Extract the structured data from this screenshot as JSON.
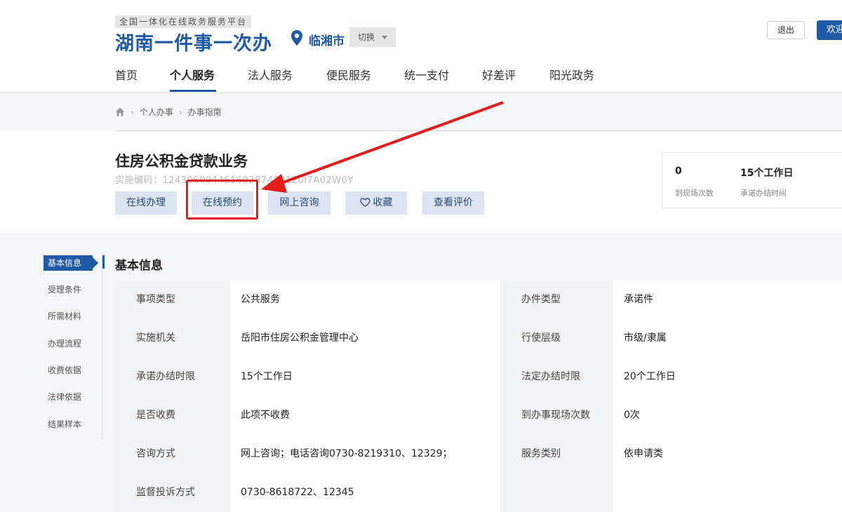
{
  "header": {
    "platform_tag": "全国一体化在线政务服务平台",
    "brand": "湖南一件事一次办",
    "city": "临湘市",
    "switch_label": "切换",
    "logout_label": "退出",
    "welcome_label": "欢迎"
  },
  "nav": {
    "items": [
      "首页",
      "个人服务",
      "法人服务",
      "便民服务",
      "统一支付",
      "好差评",
      "阳光政务"
    ],
    "active_index": 1
  },
  "breadcrumb": {
    "items": [
      "个人办事",
      "办事指南"
    ]
  },
  "service": {
    "title": "住房公积金贷款业务",
    "code": "实施编码：12430600446169287434120I7A02W0Y",
    "buttons": [
      "在线办理",
      "在线预约",
      "网上咨询",
      "收藏",
      "查看评价"
    ]
  },
  "stats": {
    "visits_value": "0",
    "visits_label": "到现场次数",
    "time_value": "15个工作日",
    "time_label": "承诺办结时间"
  },
  "sidebar": {
    "items": [
      "基本信息",
      "受理条件",
      "所需材料",
      "办理流程",
      "收费依据",
      "法律依据",
      "结果样本"
    ]
  },
  "section": {
    "title": "基本信息"
  },
  "table": {
    "rows": [
      [
        "事项类型",
        "公共服务",
        "办件类型",
        "承诺件"
      ],
      [
        "实施机关",
        "岳阳市住房公积金管理中心",
        "行使层级",
        "市级/隶属"
      ],
      [
        "承诺办结时限",
        "15个工作日",
        "法定办结时限",
        "20个工作日"
      ],
      [
        "是否收费",
        "此项不收费",
        "到办事现场次数",
        "0次"
      ],
      [
        "咨询方式",
        "网上咨询；电话咨询0730-8219310、12329；",
        "服务类别",
        "依申请类"
      ],
      [
        "监督投诉方式",
        "0730-8618722、12345",
        "",
        ""
      ]
    ]
  },
  "colors": {
    "brand_blue": "#1f5aa6",
    "highlight_red": "#e51c1c"
  }
}
